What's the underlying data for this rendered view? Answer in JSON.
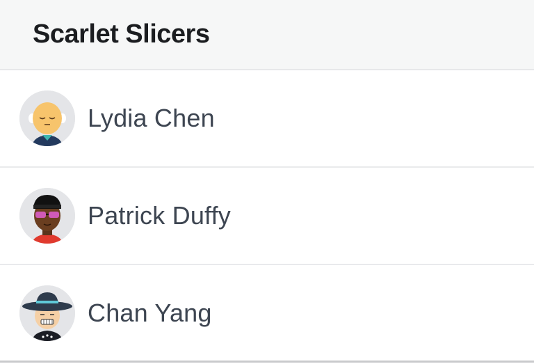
{
  "team": {
    "name": "Scarlet Slicers"
  },
  "members": [
    {
      "name": "Lydia Chen",
      "avatar_icon": "bald-person-avatar-icon"
    },
    {
      "name": "Patrick Duffy",
      "avatar_icon": "sunglasses-person-avatar-icon"
    },
    {
      "name": "Chan Yang",
      "avatar_icon": "hat-person-avatar-icon"
    }
  ],
  "colors": {
    "header_bg": "#f6f7f7",
    "title_text": "#1b1d20",
    "name_text": "#3d4551",
    "avatar_bg": "#e4e5e8",
    "divider": "#e9eaec"
  }
}
